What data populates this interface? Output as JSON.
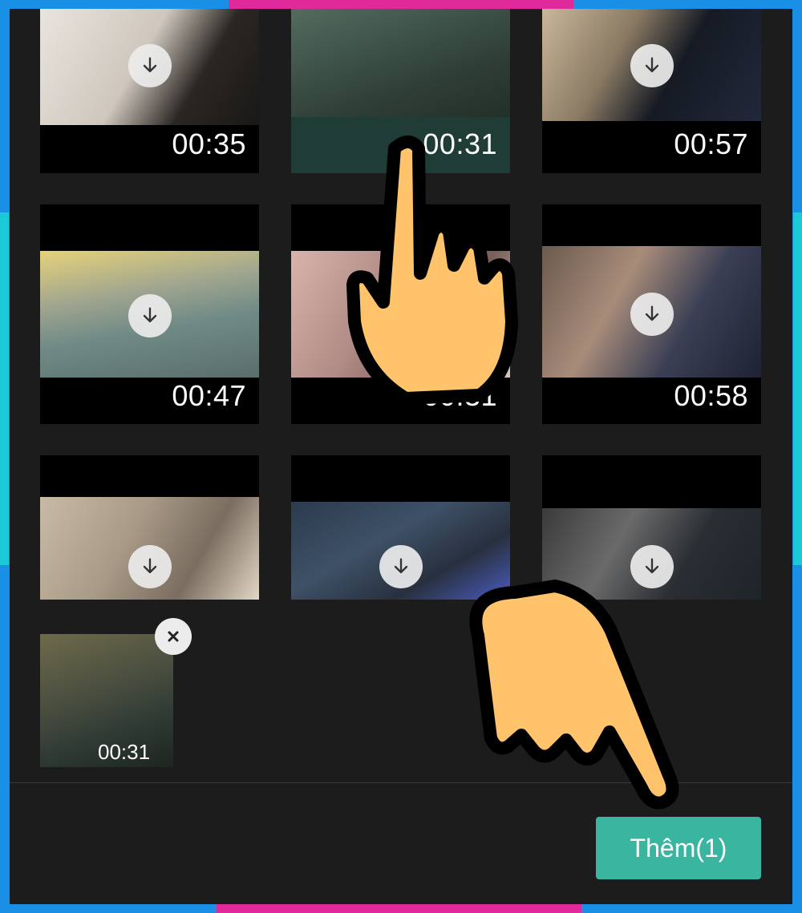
{
  "colors": {
    "frame": "#1a8fe6",
    "accent_pink": "#e0299a",
    "accent_cyan": "#19c9d6",
    "panel": "#1c1c1c",
    "add_button": "#3ab5a0",
    "hand_fill": "#ffc46b"
  },
  "icons": {
    "download": "download-arrow-icon",
    "remove": "close-icon",
    "pointer": "pointing-hand-icon"
  },
  "videos": [
    {
      "duration": "00:35"
    },
    {
      "duration": "00:31"
    },
    {
      "duration": "00:57"
    },
    {
      "duration": "00:47"
    },
    {
      "duration": "00:31"
    },
    {
      "duration": "00:58"
    },
    {
      "duration": ""
    },
    {
      "duration": ""
    },
    {
      "duration": ""
    }
  ],
  "selected": {
    "duration": "00:31"
  },
  "footer": {
    "add_button_label": "Thêm(1)"
  }
}
